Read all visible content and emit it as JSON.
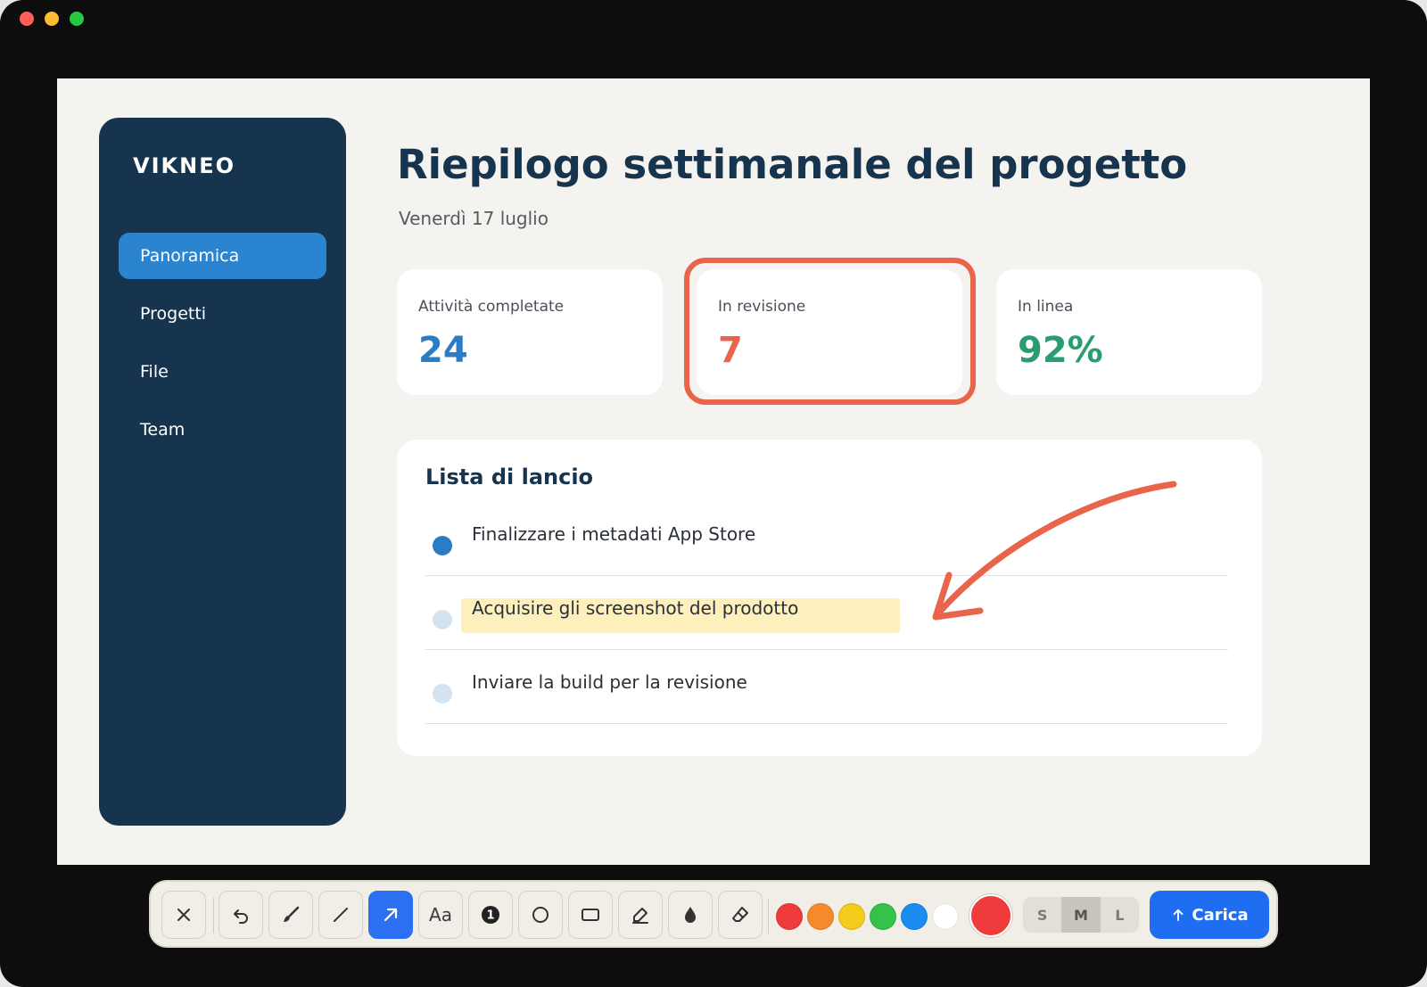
{
  "app": {
    "brand": "VIKNEO"
  },
  "sidebar": {
    "items": [
      {
        "label": "Panoramica",
        "active": true
      },
      {
        "label": "Progetti",
        "active": false
      },
      {
        "label": "File",
        "active": false
      },
      {
        "label": "Team",
        "active": false
      }
    ]
  },
  "header": {
    "title": "Riepilogo settimanale del progetto",
    "date": "Venerdì 17 luglio"
  },
  "stats": [
    {
      "label": "Attività completate",
      "value": "24",
      "color": "#2a7dc4"
    },
    {
      "label": "In revisione",
      "value": "7",
      "color": "#e8644a"
    },
    {
      "label": "In linea",
      "value": "92%",
      "color": "#2a9d6f"
    }
  ],
  "launch": {
    "title": "Lista di lancio",
    "tasks": [
      {
        "text": "Finalizzare i metadati App Store",
        "status": "done"
      },
      {
        "text": "Acquisire gli screenshot del prodotto",
        "status": "pending",
        "highlighted": true
      },
      {
        "text": "Inviare la build per la revisione",
        "status": "pending"
      }
    ]
  },
  "annotations": {
    "stroke_color": "#e8644a",
    "highlighter_color": "#fdf0bd"
  },
  "toolbar": {
    "tools": [
      "close-icon",
      "undo-icon",
      "brush-icon",
      "line-icon",
      "arrow-icon",
      "text-icon",
      "step-number-icon",
      "circle-icon",
      "rectangle-icon",
      "highlighter-icon",
      "blur-drop-icon",
      "eraser-icon"
    ],
    "active_tool": "arrow-icon",
    "text_tool_label": "Aa",
    "step_number": "1",
    "colors": [
      "#ef3b3b",
      "#f58a2a",
      "#f5cc1b",
      "#34c24a",
      "#1a8cf2",
      "#ffffff"
    ],
    "selected_color": "#ef3b3b",
    "sizes": [
      "S",
      "M",
      "L"
    ],
    "selected_size": "M",
    "upload_label": "Carica"
  }
}
